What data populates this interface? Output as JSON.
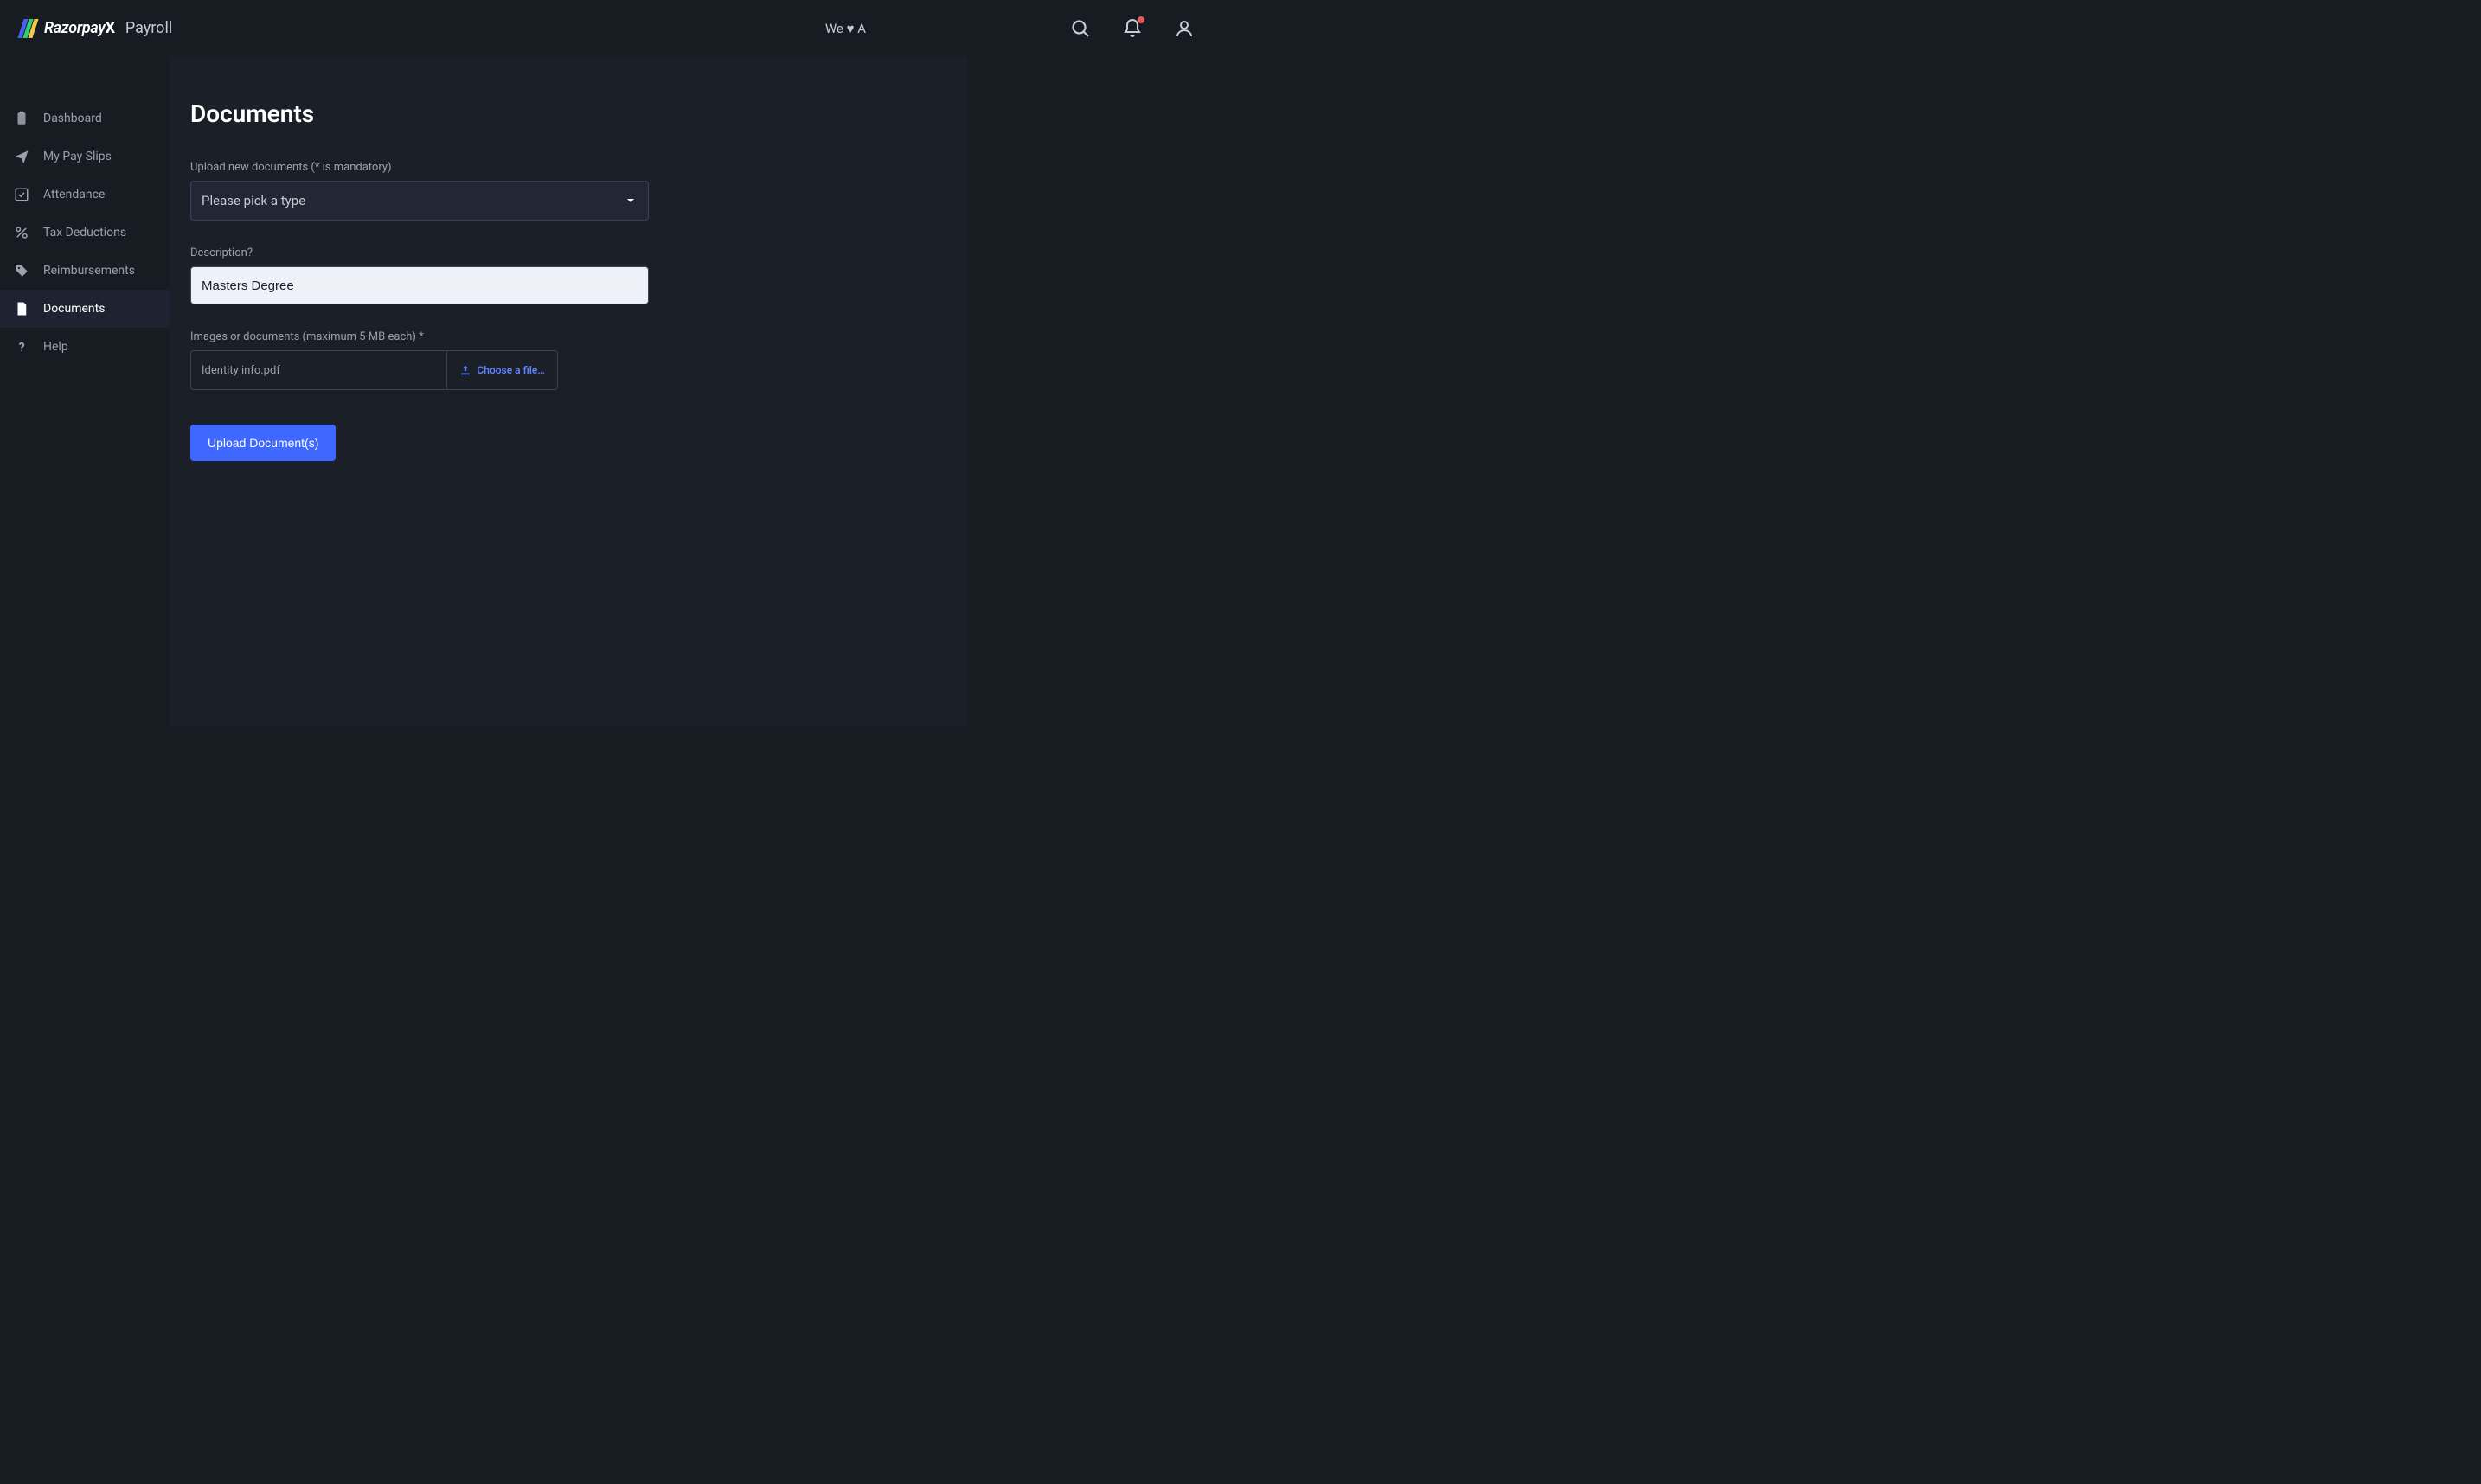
{
  "header": {
    "brand_main": "Razorpay",
    "brand_x": "X",
    "brand_sub": "Payroll",
    "tagline": "We ♥ A"
  },
  "sidebar": {
    "items": [
      {
        "label": "Dashboard"
      },
      {
        "label": "My Pay Slips"
      },
      {
        "label": "Attendance"
      },
      {
        "label": "Tax Deductions"
      },
      {
        "label": "Reimbursements"
      },
      {
        "label": "Documents"
      },
      {
        "label": "Help"
      }
    ]
  },
  "page": {
    "title": "Documents",
    "upload_label": "Upload new documents (* is mandatory)",
    "type_placeholder": "Please pick a type",
    "description_label": "Description?",
    "description_value": "Masters Degree",
    "files_label": "Images or documents (maximum 5 MB each) *",
    "selected_file": "Identity info.pdf",
    "choose_file_label": "Choose a file…",
    "submit_label": "Upload Document(s)"
  }
}
